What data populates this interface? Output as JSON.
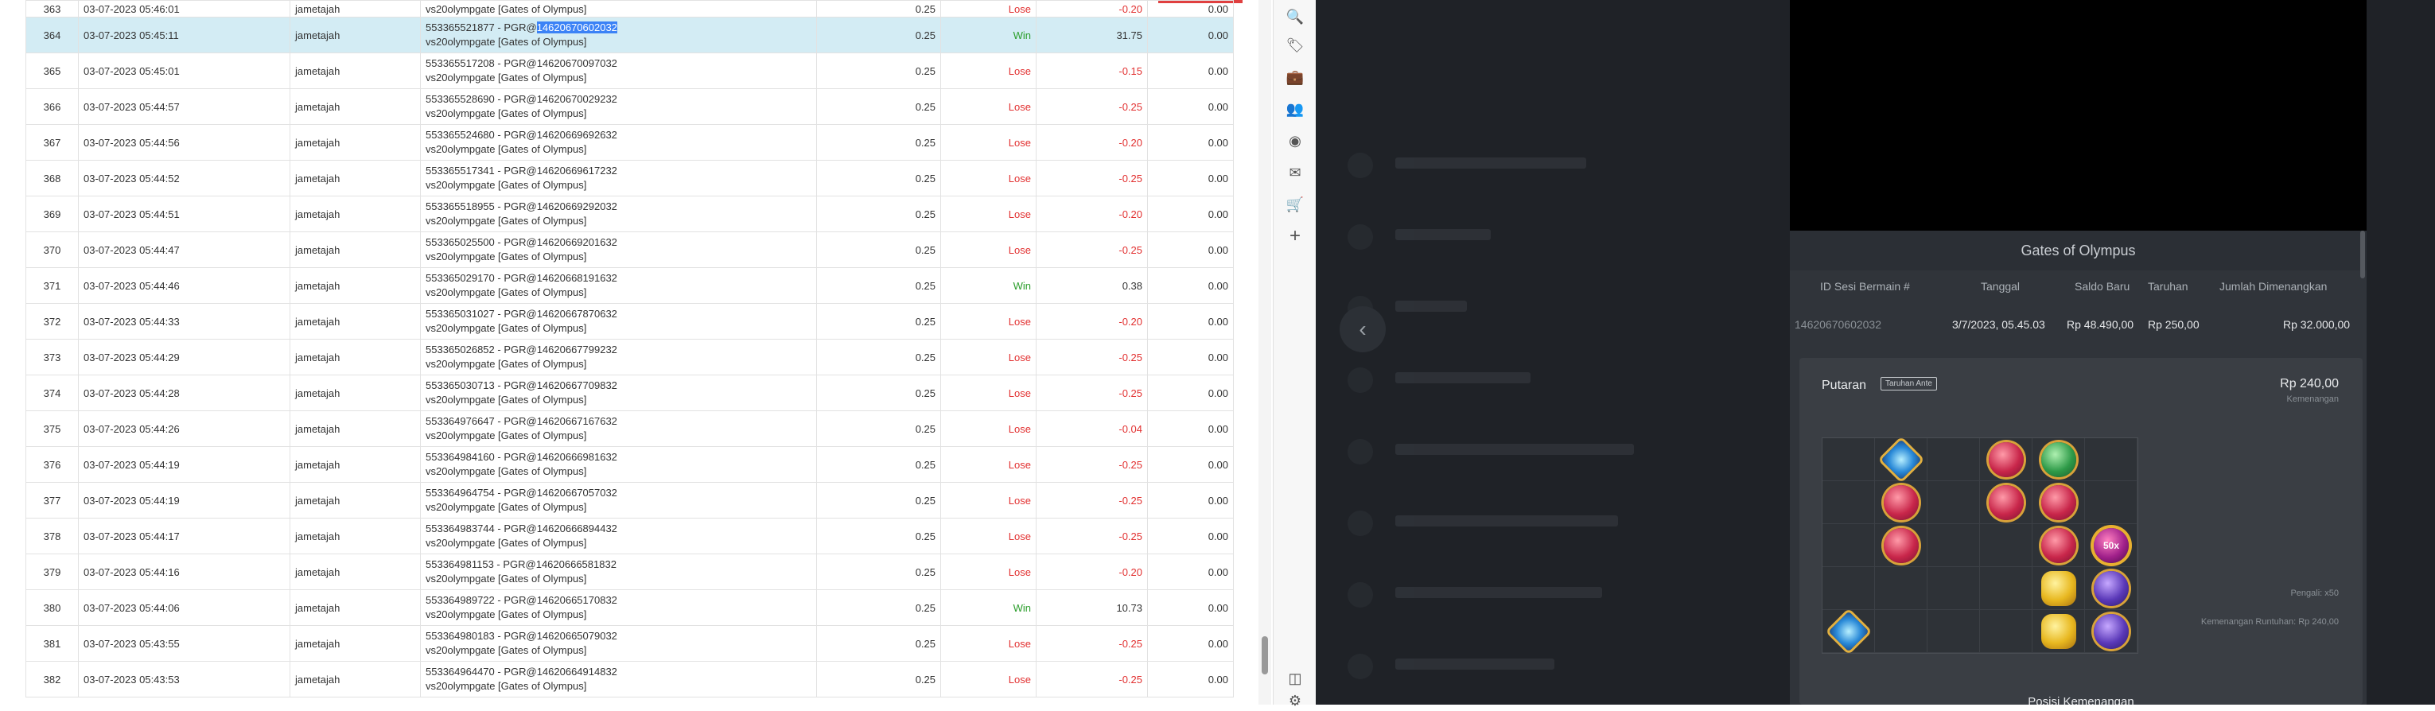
{
  "table": {
    "top_partial": {
      "no": "363",
      "date": "03-07-2023 05:46:01",
      "user": "jametajah",
      "game": "vs20olympgate [Gates of Olympus]",
      "bet": "0.25",
      "result": "Lose",
      "winloss": "-0.20",
      "bonus": "0.00"
    },
    "rows": [
      {
        "no": "364",
        "date": "03-07-2023 05:45:11",
        "user": "jametajah",
        "ref_prefix": "553365521877 - PGR@",
        "ref_id": "14620670602032",
        "game": "vs20olympgate [Gates of Olympus]",
        "bet": "0.25",
        "result": "Win",
        "winloss": "31.75",
        "bonus": "0.00",
        "selected": true
      },
      {
        "no": "365",
        "date": "03-07-2023 05:45:01",
        "user": "jametajah",
        "ref_prefix": "553365517208 - PGR@",
        "ref_id": "14620670097032",
        "game": "vs20olympgate [Gates of Olympus]",
        "bet": "0.25",
        "result": "Lose",
        "winloss": "-0.15",
        "bonus": "0.00"
      },
      {
        "no": "366",
        "date": "03-07-2023 05:44:57",
        "user": "jametajah",
        "ref_prefix": "553365528690 - PGR@",
        "ref_id": "14620670029232",
        "game": "vs20olympgate [Gates of Olympus]",
        "bet": "0.25",
        "result": "Lose",
        "winloss": "-0.25",
        "bonus": "0.00"
      },
      {
        "no": "367",
        "date": "03-07-2023 05:44:56",
        "user": "jametajah",
        "ref_prefix": "553365524680 - PGR@",
        "ref_id": "14620669692632",
        "game": "vs20olympgate [Gates of Olympus]",
        "bet": "0.25",
        "result": "Lose",
        "winloss": "-0.20",
        "bonus": "0.00"
      },
      {
        "no": "368",
        "date": "03-07-2023 05:44:52",
        "user": "jametajah",
        "ref_prefix": "553365517341 - PGR@",
        "ref_id": "14620669617232",
        "game": "vs20olympgate [Gates of Olympus]",
        "bet": "0.25",
        "result": "Lose",
        "winloss": "-0.25",
        "bonus": "0.00"
      },
      {
        "no": "369",
        "date": "03-07-2023 05:44:51",
        "user": "jametajah",
        "ref_prefix": "553365518955 - PGR@",
        "ref_id": "14620669292032",
        "game": "vs20olympgate [Gates of Olympus]",
        "bet": "0.25",
        "result": "Lose",
        "winloss": "-0.20",
        "bonus": "0.00"
      },
      {
        "no": "370",
        "date": "03-07-2023 05:44:47",
        "user": "jametajah",
        "ref_prefix": "553365025500 - PGR@",
        "ref_id": "14620669201632",
        "game": "vs20olympgate [Gates of Olympus]",
        "bet": "0.25",
        "result": "Lose",
        "winloss": "-0.25",
        "bonus": "0.00"
      },
      {
        "no": "371",
        "date": "03-07-2023 05:44:46",
        "user": "jametajah",
        "ref_prefix": "553365029170 - PGR@",
        "ref_id": "14620668191632",
        "game": "vs20olympgate [Gates of Olympus]",
        "bet": "0.25",
        "result": "Win",
        "winloss": "0.38",
        "bonus": "0.00"
      },
      {
        "no": "372",
        "date": "03-07-2023 05:44:33",
        "user": "jametajah",
        "ref_prefix": "553365031027 - PGR@",
        "ref_id": "14620667870632",
        "game": "vs20olympgate [Gates of Olympus]",
        "bet": "0.25",
        "result": "Lose",
        "winloss": "-0.20",
        "bonus": "0.00"
      },
      {
        "no": "373",
        "date": "03-07-2023 05:44:29",
        "user": "jametajah",
        "ref_prefix": "553365026852 - PGR@",
        "ref_id": "14620667799232",
        "game": "vs20olympgate [Gates of Olympus]",
        "bet": "0.25",
        "result": "Lose",
        "winloss": "-0.25",
        "bonus": "0.00"
      },
      {
        "no": "374",
        "date": "03-07-2023 05:44:28",
        "user": "jametajah",
        "ref_prefix": "553365030713 - PGR@",
        "ref_id": "14620667709832",
        "game": "vs20olympgate [Gates of Olympus]",
        "bet": "0.25",
        "result": "Lose",
        "winloss": "-0.25",
        "bonus": "0.00"
      },
      {
        "no": "375",
        "date": "03-07-2023 05:44:26",
        "user": "jametajah",
        "ref_prefix": "553364976647 - PGR@",
        "ref_id": "14620667167632",
        "game": "vs20olympgate [Gates of Olympus]",
        "bet": "0.25",
        "result": "Lose",
        "winloss": "-0.04",
        "bonus": "0.00"
      },
      {
        "no": "376",
        "date": "03-07-2023 05:44:19",
        "user": "jametajah",
        "ref_prefix": "553364984160 - PGR@",
        "ref_id": "14620666981632",
        "game": "vs20olympgate [Gates of Olympus]",
        "bet": "0.25",
        "result": "Lose",
        "winloss": "-0.25",
        "bonus": "0.00"
      },
      {
        "no": "377",
        "date": "03-07-2023 05:44:19",
        "user": "jametajah",
        "ref_prefix": "553364964754 - PGR@",
        "ref_id": "14620667057032",
        "game": "vs20olympgate [Gates of Olympus]",
        "bet": "0.25",
        "result": "Lose",
        "winloss": "-0.25",
        "bonus": "0.00"
      },
      {
        "no": "378",
        "date": "03-07-2023 05:44:17",
        "user": "jametajah",
        "ref_prefix": "553364983744 - PGR@",
        "ref_id": "14620666894432",
        "game": "vs20olympgate [Gates of Olympus]",
        "bet": "0.25",
        "result": "Lose",
        "winloss": "-0.25",
        "bonus": "0.00"
      },
      {
        "no": "379",
        "date": "03-07-2023 05:44:16",
        "user": "jametajah",
        "ref_prefix": "553364981153 - PGR@",
        "ref_id": "14620666581832",
        "game": "vs20olympgate [Gates of Olympus]",
        "bet": "0.25",
        "result": "Lose",
        "winloss": "-0.20",
        "bonus": "0.00"
      },
      {
        "no": "380",
        "date": "03-07-2023 05:44:06",
        "user": "jametajah",
        "ref_prefix": "553364989722 - PGR@",
        "ref_id": "14620665170832",
        "game": "vs20olympgate [Gates of Olympus]",
        "bet": "0.25",
        "result": "Win",
        "winloss": "10.73",
        "bonus": "0.00"
      },
      {
        "no": "381",
        "date": "03-07-2023 05:43:55",
        "user": "jametajah",
        "ref_prefix": "553364980183 - PGR@",
        "ref_id": "14620665079032",
        "game": "vs20olympgate [Gates of Olympus]",
        "bet": "0.25",
        "result": "Lose",
        "winloss": "-0.25",
        "bonus": "0.00"
      },
      {
        "no": "382",
        "date": "03-07-2023 05:43:53",
        "user": "jametajah",
        "ref_prefix": "553364964470 - PGR@",
        "ref_id": "14620664914832",
        "game": "vs20olympgate [Gates of Olympus]",
        "bet": "0.25",
        "result": "Lose",
        "winloss": "-0.25",
        "bonus": "0.00"
      }
    ]
  },
  "edge_rail": {
    "icons": [
      "search-icon",
      "tag-icon",
      "briefcase-icon",
      "people-icon",
      "circle-app-icon",
      "outlook-icon",
      "shopping-cart-icon",
      "add-icon",
      "sidebar-toggle-icon",
      "settings-icon"
    ],
    "glyphs": {
      "search": "🔍",
      "tag": "🏷",
      "briefcase": "💼",
      "people": "👥",
      "circle": "◉",
      "outlook": "✉",
      "cart": "🛒",
      "add": "+",
      "sidebar": "◫",
      "settings": "⚙"
    }
  },
  "overlay": {
    "back_glyph": "‹"
  },
  "modal": {
    "title": "Gates of Olympus",
    "headers": {
      "session": "ID Sesi Bermain #",
      "date": "Tanggal",
      "balance": "Saldo Baru",
      "bet": "Taruhan",
      "win": "Jumlah Dimenangkan"
    },
    "values": {
      "session": "14620670602032",
      "date": "3/7/2023, 05.45.03",
      "balance": "Rp 48.490,00",
      "bet": "Rp 250,00",
      "win": "Rp 32.000,00"
    },
    "putaran": "Putaran",
    "ante_badge": "Taruhan Ante",
    "win_amount": "Rp 240,00",
    "win_label": "Kemenangan",
    "bomb_label": "50x",
    "pengali": "Pengali: x50",
    "kemenangan_runtuhan": "Kemenangan Runtuhan: Rp 240,00",
    "posisi": "Posisi Kemenangan"
  }
}
